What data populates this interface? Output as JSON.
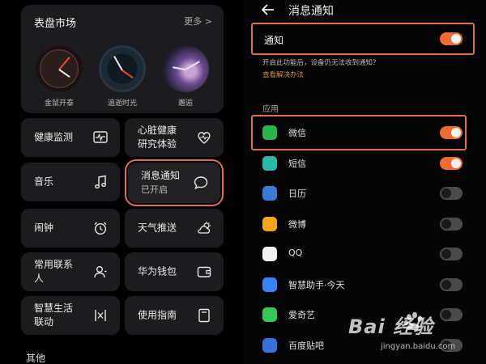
{
  "watch_app": {
    "market": {
      "title": "表盘市场",
      "more": "更多 >",
      "faces": [
        {
          "name": "金鼠开泰"
        },
        {
          "name": "追逝时光"
        },
        {
          "name": "邂逅"
        }
      ]
    },
    "tiles": {
      "health_monitor": "健康监测",
      "heart_line1": "心脏健康",
      "heart_line2": "研究体验",
      "music": "音乐",
      "notify_title": "消息通知",
      "notify_status": "已开启",
      "alarm": "闹钟",
      "weather": "天气推送",
      "contacts_line1": "常用联系",
      "contacts_line2": "人",
      "wallet": "华为钱包",
      "smartlife_line1": "智慧生活",
      "smartlife_line2": "联动",
      "guide": "使用指南"
    },
    "other_section": "其他"
  },
  "notifications": {
    "header_title": "消息通知",
    "master_label": "通知",
    "master_on": true,
    "hint": "开启此功能后，设备仍无法收到通知？",
    "hint_link": "查看解决办法",
    "section_label": "应用",
    "apps": [
      {
        "name": "微信",
        "on": true,
        "icon_color": "#2bb24c",
        "icon": "wechat-icon"
      },
      {
        "name": "短信",
        "on": true,
        "icon_color": "#2ab8a6",
        "icon": "sms-icon"
      },
      {
        "name": "日历",
        "on": false,
        "icon_color": "#3a7bd5",
        "icon": "calendar-icon"
      },
      {
        "name": "微博",
        "on": false,
        "icon_color": "#f4a51c",
        "icon": "weibo-icon"
      },
      {
        "name": "QQ",
        "on": false,
        "icon_color": "#f2f2f2",
        "icon": "qq-icon"
      },
      {
        "name": "智慧助手·今天",
        "on": false,
        "icon_color": "#3b82f6",
        "icon": "assistant-icon"
      },
      {
        "name": "爱奇艺",
        "on": false,
        "icon_color": "#34c759",
        "icon": "iqiyi-icon"
      },
      {
        "name": "百度贴吧",
        "on": false,
        "icon_color": "#3a6fe0",
        "icon": "tieba-icon"
      }
    ]
  },
  "watermark": {
    "brand": "Bai 经验",
    "url": "jingyan.baidu.com"
  },
  "colors": {
    "accent": "#f06b2d",
    "highlight_outline": "#e2704a"
  }
}
